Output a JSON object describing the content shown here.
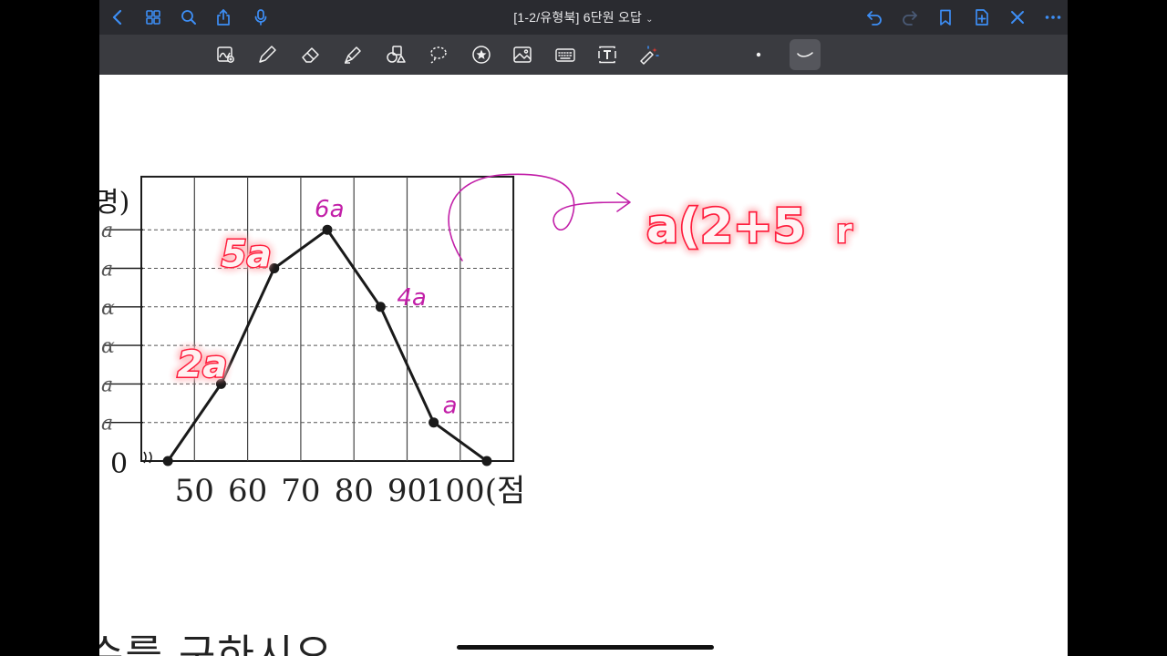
{
  "navbar": {
    "title": "[1-2/유형북] 6단원 오답",
    "title_chevron": "⌄",
    "left_icons": [
      "back-icon",
      "thumbnails-icon",
      "search-icon",
      "share-icon",
      "microphone-icon"
    ],
    "right_icons": [
      "undo-icon",
      "redo-icon",
      "bookmark-icon",
      "add-page-icon",
      "close-icon",
      "more-icon"
    ],
    "accent_color": "#3d8ef5"
  },
  "toolbar": {
    "tools": [
      "zoom-window-tool",
      "pen-tool",
      "eraser-tool",
      "highlighter-tool",
      "shapes-tool",
      "lasso-tool",
      "elements-tool",
      "image-tool",
      "keyboard-tool",
      "text-tool",
      "laser-pointer-tool"
    ],
    "stroke_sizes": [
      "dot",
      "curve"
    ],
    "selected_stroke": "curve"
  },
  "chart_data": {
    "type": "line",
    "x_ticks": [
      "50",
      "60",
      "70",
      "80",
      "90",
      "100(점"
    ],
    "y_axis_label_partial": "명)",
    "y_zero_label": "0",
    "points": [
      {
        "x": 45,
        "y": 0
      },
      {
        "x": 55,
        "y": 2
      },
      {
        "x": 65,
        "y": 5
      },
      {
        "x": 75,
        "y": 6
      },
      {
        "x": 85,
        "y": 4
      },
      {
        "x": 95,
        "y": 1
      },
      {
        "x": 105,
        "y": 0
      }
    ],
    "xlim": [
      40,
      110
    ],
    "ylim": [
      0,
      7
    ],
    "grid": true
  },
  "annotations": {
    "printed_y_marks": [
      "a",
      "a",
      "ɑ",
      "ɑ",
      "a",
      "a"
    ],
    "point_labels": [
      "2a",
      "5a",
      "6a",
      "4a",
      "a"
    ],
    "equation": "a(2+5",
    "equation_tail": "r",
    "colors": {
      "highlight": "#ff1a3c",
      "pen": "#c21fa8",
      "ink": "#1a1a1a"
    }
  },
  "question": {
    "text": "수를 구하시오."
  }
}
